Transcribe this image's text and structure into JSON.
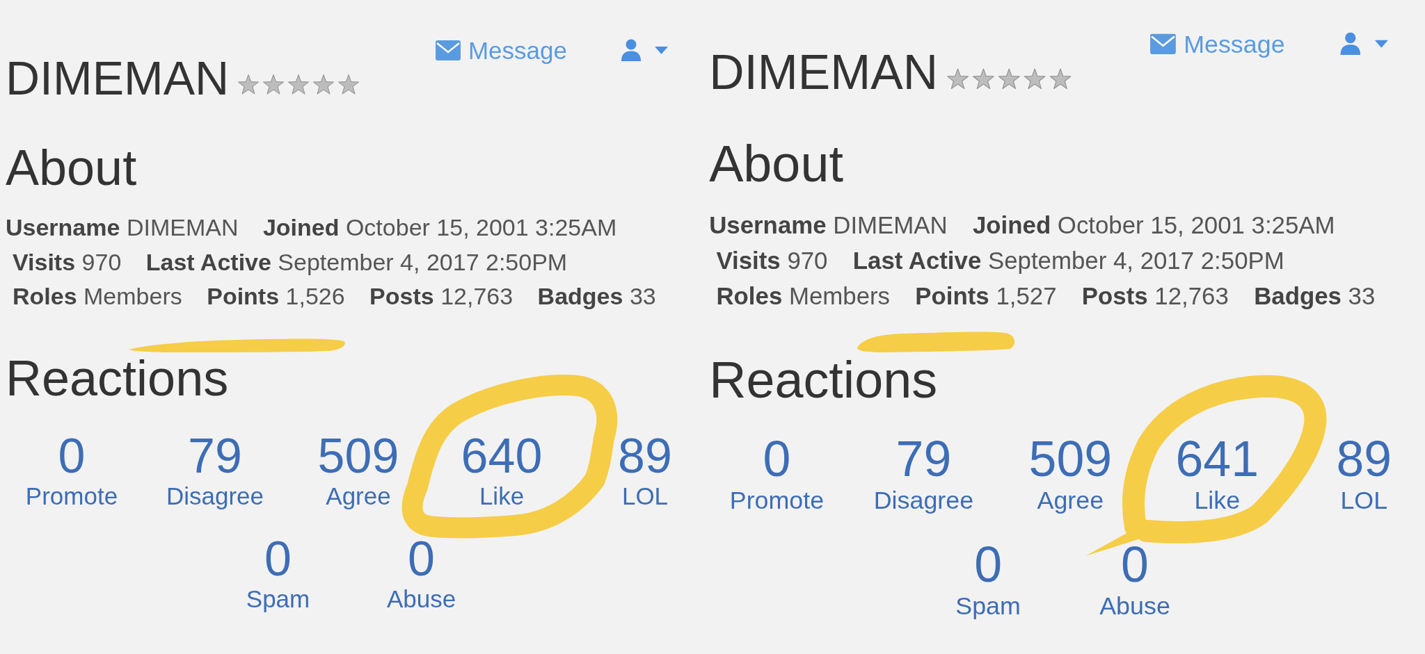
{
  "panels": [
    {
      "header": {
        "name": "DIMEMAN",
        "stars": 0,
        "message_link": "Message"
      },
      "about": {
        "heading": "About",
        "fields": [
          {
            "label": "Username",
            "value": "DIMEMAN"
          },
          {
            "label": "Joined",
            "value": "October 15, 2001 3:25AM"
          },
          {
            "label": "Visits",
            "value": "970"
          },
          {
            "label": "Last Active",
            "value": "September 4, 2017 2:50PM"
          },
          {
            "label": "Roles",
            "value": "Members"
          },
          {
            "label": "Points",
            "value": "1,526"
          },
          {
            "label": "Posts",
            "value": "12,763"
          },
          {
            "label": "Badges",
            "value": "33"
          }
        ]
      },
      "reactions": {
        "heading": "Reactions",
        "rows": [
          {
            "items": [
              {
                "count": "0",
                "label": "Promote"
              },
              {
                "count": "79",
                "label": "Disagree"
              },
              {
                "count": "509",
                "label": "Agree"
              },
              {
                "count": "640",
                "label": "Like"
              },
              {
                "count": "89",
                "label": "LOL"
              }
            ]
          },
          {
            "items": [
              {
                "count": "0",
                "label": "Spam"
              },
              {
                "count": "0",
                "label": "Abuse"
              }
            ]
          }
        ]
      }
    },
    {
      "header": {
        "name": "DIMEMAN",
        "stars": 0,
        "message_link": "Message"
      },
      "about": {
        "heading": "About",
        "fields": [
          {
            "label": "Username",
            "value": "DIMEMAN"
          },
          {
            "label": "Joined",
            "value": "October 15, 2001 3:25AM"
          },
          {
            "label": "Visits",
            "value": "970"
          },
          {
            "label": "Last Active",
            "value": "September 4, 2017 2:50PM"
          },
          {
            "label": "Roles",
            "value": "Members"
          },
          {
            "label": "Points",
            "value": "1,527"
          },
          {
            "label": "Posts",
            "value": "12,763"
          },
          {
            "label": "Badges",
            "value": "33"
          }
        ]
      },
      "reactions": {
        "heading": "Reactions",
        "rows": [
          {
            "items": [
              {
                "count": "0",
                "label": "Promote"
              },
              {
                "count": "79",
                "label": "Disagree"
              },
              {
                "count": "509",
                "label": "Agree"
              },
              {
                "count": "641",
                "label": "Like"
              },
              {
                "count": "89",
                "label": "LOL"
              }
            ]
          },
          {
            "items": [
              {
                "count": "0",
                "label": "Spam"
              },
              {
                "count": "0",
                "label": "Abuse"
              }
            ]
          }
        ]
      }
    }
  ]
}
